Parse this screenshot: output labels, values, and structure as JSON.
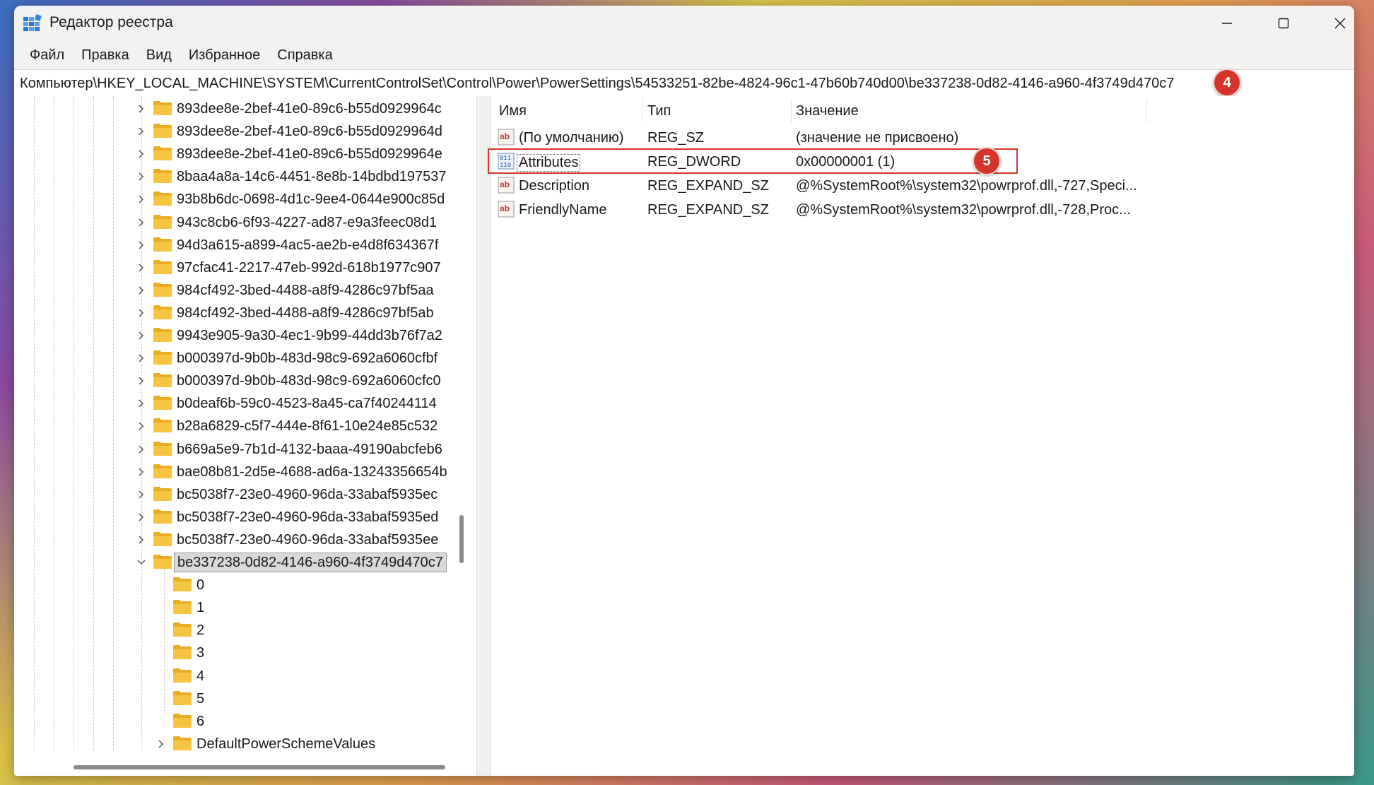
{
  "window": {
    "title": "Редактор реестра",
    "controls": {
      "minimize": "minimize-icon",
      "maximize": "maximize-icon",
      "close": "close-icon"
    }
  },
  "menu": [
    "Файл",
    "Правка",
    "Вид",
    "Избранное",
    "Справка"
  ],
  "address": "Компьютер\\HKEY_LOCAL_MACHINE\\SYSTEM\\CurrentControlSet\\Control\\Power\\PowerSettings\\54533251-82be-4824-96c1-47b60b740d00\\be337238-0d82-4146-a960-4f3749d470c7",
  "annotations": {
    "address_marker": "4",
    "row_marker": "5"
  },
  "colors": {
    "annotation_red": "#d6342a",
    "folder_yellow": "#f5c542",
    "selection_gray": "#d9d9d9"
  },
  "tree": {
    "keys": [
      "893dee8e-2bef-41e0-89c6-b55d0929964c",
      "893dee8e-2bef-41e0-89c6-b55d0929964d",
      "893dee8e-2bef-41e0-89c6-b55d0929964e",
      "8baa4a8a-14c6-4451-8e8b-14bdbd197537",
      "93b8b6dc-0698-4d1c-9ee4-0644e900c85d",
      "943c8cb6-6f93-4227-ad87-e9a3feec08d1",
      "94d3a615-a899-4ac5-ae2b-e4d8f634367f",
      "97cfac41-2217-47eb-992d-618b1977c907",
      "984cf492-3bed-4488-a8f9-4286c97bf5aa",
      "984cf492-3bed-4488-a8f9-4286c97bf5ab",
      "9943e905-9a30-4ec1-9b99-44dd3b76f7a2",
      "b000397d-9b0b-483d-98c9-692a6060cfbf",
      "b000397d-9b0b-483d-98c9-692a6060cfc0",
      "b0deaf6b-59c0-4523-8a45-ca7f40244114",
      "b28a6829-c5f7-444e-8f61-10e24e85c532",
      "b669a5e9-7b1d-4132-baaa-49190abcfeb6",
      "bae08b81-2d5e-4688-ad6a-13243356654b",
      "bc5038f7-23e0-4960-96da-33abaf5935ec",
      "bc5038f7-23e0-4960-96da-33abaf5935ed",
      "bc5038f7-23e0-4960-96da-33abaf5935ee"
    ],
    "selected": "be337238-0d82-4146-a960-4f3749d470c7",
    "children": [
      "0",
      "1",
      "2",
      "3",
      "4",
      "5",
      "6"
    ],
    "child_expandable": "DefaultPowerSchemeValues"
  },
  "list": {
    "columns": {
      "name": "Имя",
      "type": "Тип",
      "value": "Значение"
    },
    "rows": [
      {
        "name": "(По умолчанию)",
        "type": "REG_SZ",
        "value": "(значение не присвоено)",
        "icon": "string-value-icon"
      },
      {
        "name": "Attributes",
        "type": "REG_DWORD",
        "value": "0x00000001 (1)",
        "icon": "binary-value-icon"
      },
      {
        "name": "Description",
        "type": "REG_EXPAND_SZ",
        "value": "@%SystemRoot%\\system32\\powrprof.dll,-727,Speci...",
        "icon": "string-value-icon"
      },
      {
        "name": "FriendlyName",
        "type": "REG_EXPAND_SZ",
        "value": "@%SystemRoot%\\system32\\powrprof.dll,-728,Proc...",
        "icon": "string-value-icon"
      }
    ]
  }
}
